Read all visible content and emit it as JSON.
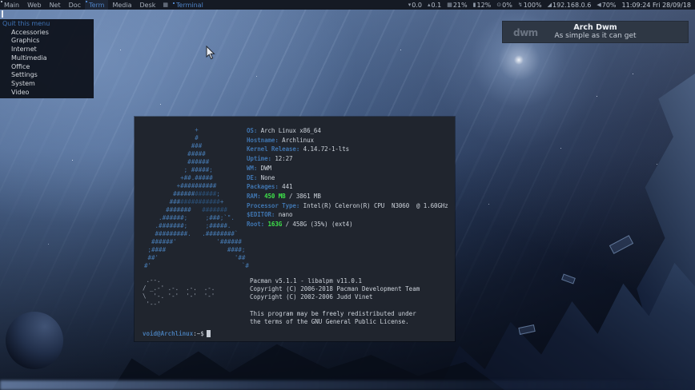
{
  "colors": {
    "accent_blue": "#4f83c6",
    "label_blue": "#3f74ae",
    "green": "#3ee04a",
    "bar_bg": "#151a24",
    "terminal_bg": "#20252e",
    "banner_bg": "#2e3744"
  },
  "topbar": {
    "tags": [
      {
        "label": "Main",
        "selected": false,
        "occupied": true
      },
      {
        "label": "Web",
        "selected": false,
        "occupied": false
      },
      {
        "label": "Net",
        "selected": false,
        "occupied": false
      },
      {
        "label": "Doc",
        "selected": false,
        "occupied": false
      },
      {
        "label": "Term",
        "selected": true,
        "occupied": true
      },
      {
        "label": "Media",
        "selected": false,
        "occupied": false
      },
      {
        "label": "Desk",
        "selected": false,
        "occupied": false
      }
    ],
    "layout_icon": "▦",
    "window_title": "Terminal",
    "status": [
      {
        "name": "net-down",
        "icon": "▾",
        "value": "0.0"
      },
      {
        "name": "net-up",
        "icon": "▴",
        "value": "0.1"
      },
      {
        "name": "cpu",
        "icon": "▦",
        "value": "21%"
      },
      {
        "name": "memory",
        "icon": "▮",
        "value": "12%"
      },
      {
        "name": "swap",
        "icon": "⊙",
        "value": "0%"
      },
      {
        "name": "power",
        "icon": "↯",
        "value": "100%"
      },
      {
        "name": "network-ip",
        "icon": "◢",
        "value": "192.168.0.6"
      },
      {
        "name": "volume",
        "icon": "◀",
        "value": "70%"
      }
    ],
    "clock": "11:09:24 Fri 28/09/18"
  },
  "menu": {
    "quit_label": "Quit this menu",
    "items": [
      "Accessories",
      "Graphics",
      "Internet",
      "Multimedia",
      "Office",
      "Settings",
      "System",
      "Video"
    ]
  },
  "banner": {
    "logo": "dwm",
    "title": "Arch Dwm",
    "subtitle": "As simple as it can get"
  },
  "terminal": {
    "ascii_art": [
      [
        [
          1,
          "              +"
        ]
      ],
      [
        [
          1,
          "              #"
        ]
      ],
      [
        [
          1,
          "             ###"
        ]
      ],
      [
        [
          1,
          "            #####"
        ]
      ],
      [
        [
          1,
          "            ######"
        ]
      ],
      [
        [
          1,
          "           ; #####;"
        ]
      ],
      [
        [
          1,
          "          +##.#####"
        ]
      ],
      [
        [
          1,
          "         +##########"
        ]
      ],
      [
        [
          1,
          "        ######"
        ],
        [
          2,
          "######"
        ],
        [
          1,
          ";"
        ]
      ],
      [
        [
          1,
          "       ###"
        ],
        [
          2,
          "###########"
        ],
        [
          1,
          "+"
        ]
      ],
      [
        [
          1,
          "      #######   "
        ],
        [
          2,
          "#######"
        ]
      ],
      [
        [
          1,
          "    .######;     ;###;`\"."
        ]
      ],
      [
        [
          1,
          "   .#######;     ;#####."
        ]
      ],
      [
        [
          1,
          "   #########.   .########`"
        ]
      ],
      [
        [
          1,
          "  ######'           '######"
        ]
      ],
      [
        [
          1,
          " ;####                 ####;"
        ]
      ],
      [
        [
          1,
          " ##'                     '##"
        ]
      ],
      [
        [
          1,
          "#'                         `#"
        ]
      ]
    ],
    "info": [
      {
        "label": "OS:",
        "value": "Arch Linux x86_64"
      },
      {
        "label": "Hostname:",
        "value": "Archlinux"
      },
      {
        "label": "Kernel Release:",
        "value": "4.14.72-1-lts"
      },
      {
        "label": "Uptime:",
        "value": "12:27"
      },
      {
        "label": "WM:",
        "value": "DWM"
      },
      {
        "label": "DE:",
        "value": "None"
      },
      {
        "label": "Packages:",
        "value": "441"
      },
      {
        "label": "RAM:",
        "highlight": "450 MB",
        "value": " / 3861 MB"
      },
      {
        "label": "Processor Type:",
        "value": "Intel(R) Celeron(R) CPU  N3060  @ 1.60GHz"
      },
      {
        "label": "$EDITOR:",
        "value": "nano"
      },
      {
        "label": "Root:",
        "highlight": "163G",
        "value": " / 458G (35%) (ext4)"
      }
    ],
    "pacman_art": [
      " .--.",
      "/ _.-' .-.  .-.  .-.",
      "\\  '-. '-'  '-'  '-'",
      " '--'"
    ],
    "pacman_info": [
      "Pacman v5.1.1 - libalpm v11.0.1",
      "Copyright (C) 2006-2018 Pacman Development Team",
      "Copyright (C) 2002-2006 Judd Vinet",
      "",
      "This program may be freely redistributed under",
      "the terms of the GNU General Public License."
    ],
    "prompt": {
      "user_host": "void@Archlinux",
      "suffix": ":~$"
    }
  }
}
